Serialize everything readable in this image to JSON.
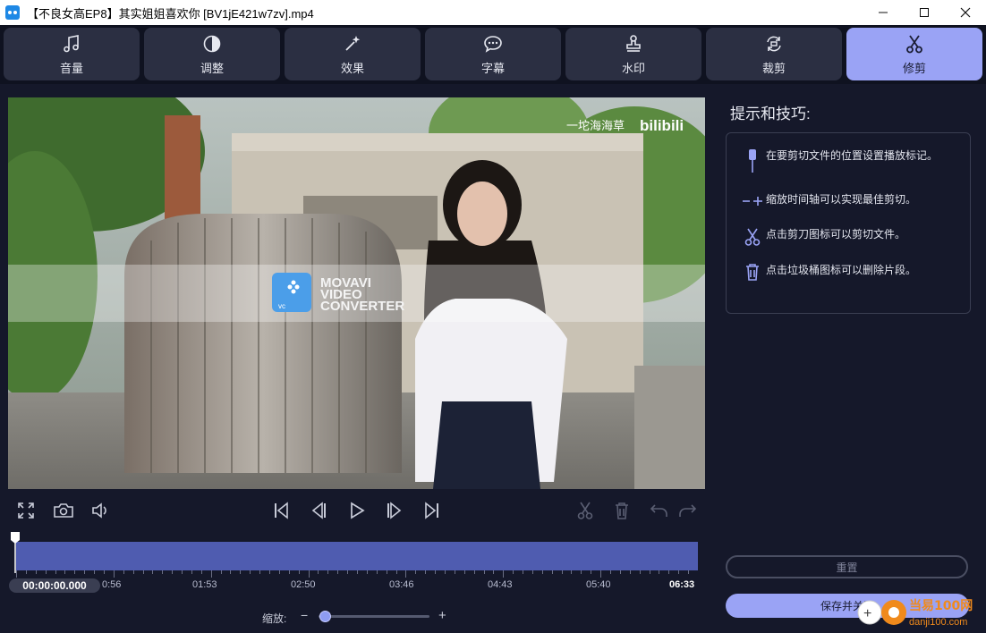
{
  "window": {
    "title": "【不良女高EP8】其实姐姐喜欢你 [BV1jE421w7zv].mp4",
    "minimize_glyph": "—",
    "maximize_glyph": "☐",
    "close_glyph": "✕"
  },
  "tabs": [
    {
      "label": "音量",
      "icon": "music-note-icon"
    },
    {
      "label": "调整",
      "icon": "contrast-icon"
    },
    {
      "label": "效果",
      "icon": "magic-wand-icon"
    },
    {
      "label": "字幕",
      "icon": "speech-bubble-icon"
    },
    {
      "label": "水印",
      "icon": "stamp-icon"
    },
    {
      "label": "裁剪",
      "icon": "crop-rotate-icon"
    },
    {
      "label": "修剪",
      "icon": "scissors-icon",
      "active": true
    }
  ],
  "video": {
    "watermark_channel": "一坨海海草",
    "watermark_brand": "bilibili",
    "overlay_line1": "MOVAVI",
    "overlay_line2": "VIDEO",
    "overlay_line3": "CONVERTER",
    "overlay_badge": "vc"
  },
  "timeline": {
    "current_time": "00:00:00.000",
    "end_time": "06:33",
    "ticks": [
      "0:56",
      "01:53",
      "02:50",
      "03:46",
      "04:43",
      "05:40"
    ],
    "zoom_label": "缩放:",
    "zoom_minus": "−",
    "zoom_plus": "+",
    "zoom_level": 0.05
  },
  "tips": {
    "title": "提示和技巧:",
    "items": [
      {
        "text": "在要剪切文件的位置设置播放标记。",
        "icon": "marker-icon"
      },
      {
        "text": "缩放时间轴可以实现最佳剪切。",
        "icon": "zoom-timeline-icon"
      },
      {
        "text": "点击剪刀图标可以剪切文件。",
        "icon": "scissors-icon"
      },
      {
        "text": "点击垃圾桶图标可以删除片段。",
        "icon": "trash-icon"
      }
    ]
  },
  "buttons": {
    "reset": "重置",
    "save_close": "保存并关闭"
  },
  "site_watermark": {
    "name": "当易100网",
    "url": "danji100.com"
  },
  "colors": {
    "accent": "#9aa3f5",
    "timeline": "#4f5cb0",
    "background": "#15182a",
    "tab_bg": "#2b2f42"
  }
}
